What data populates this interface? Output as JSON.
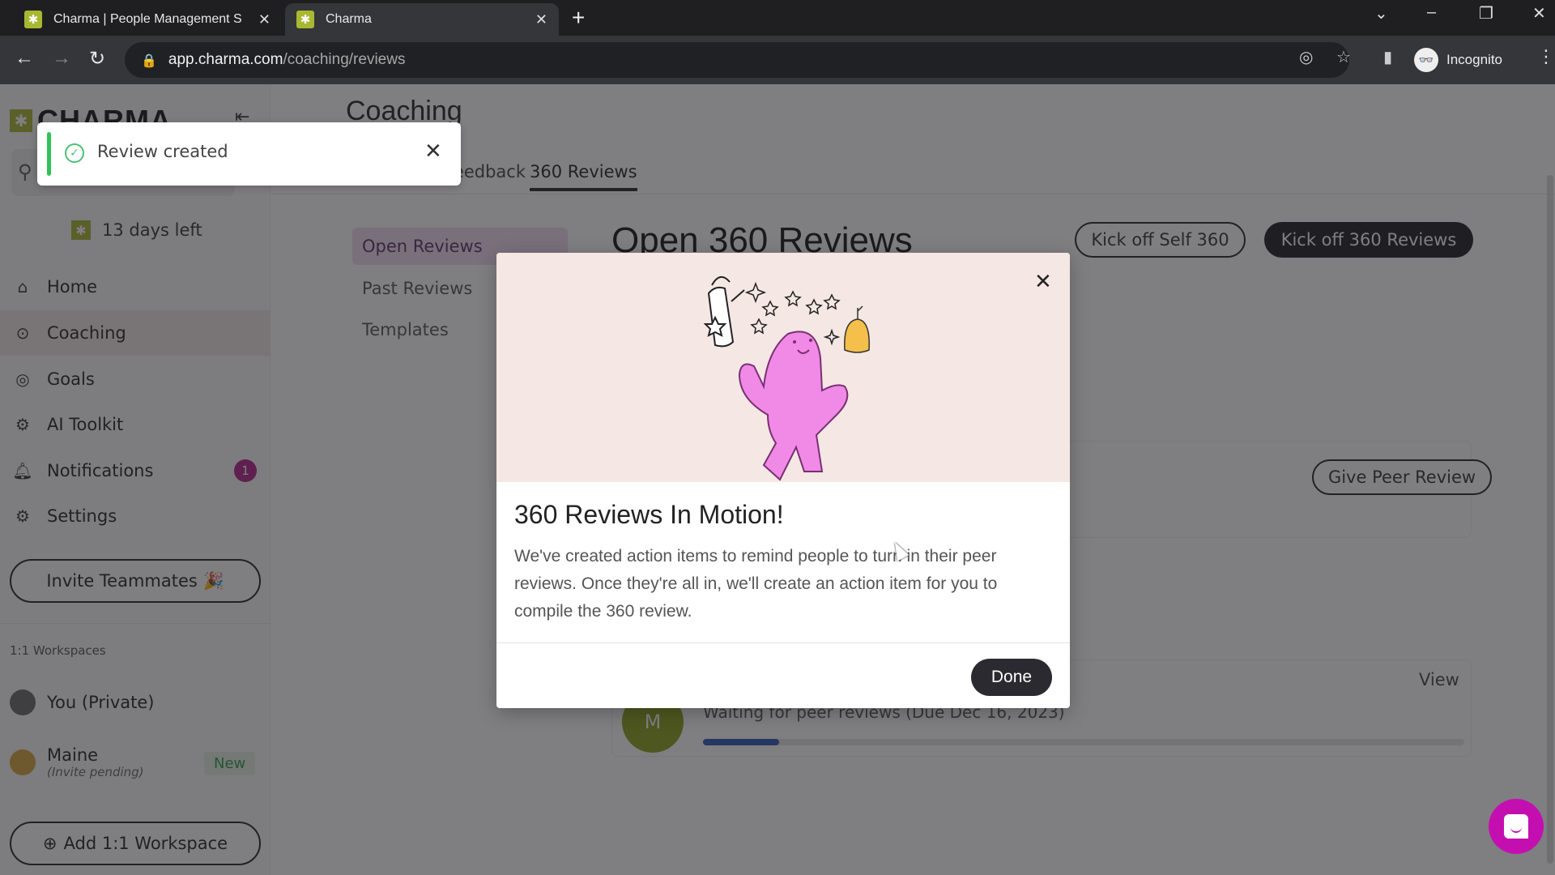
{
  "browser": {
    "tabs": [
      {
        "title": "Charma | People Management S",
        "active": false
      },
      {
        "title": "Charma",
        "active": true
      }
    ],
    "new_tab_icon": "plus-icon",
    "url_host": "app.charma.com",
    "url_path": "/coaching/reviews",
    "profile_label": "Incognito"
  },
  "sidebar": {
    "logo_text": "CHARMA",
    "trial_text": "13 days left",
    "nav": [
      {
        "label": "Home",
        "icon": "home-icon",
        "active": false
      },
      {
        "label": "Coaching",
        "icon": "coaching-whistle-icon",
        "active": true
      },
      {
        "label": "Goals",
        "icon": "target-icon",
        "active": false
      },
      {
        "label": "AI Toolkit",
        "icon": "robot-icon",
        "active": false
      },
      {
        "label": "Notifications",
        "icon": "bell-icon",
        "active": false,
        "badge": "1"
      },
      {
        "label": "Settings",
        "icon": "gear-icon",
        "active": false
      }
    ],
    "invite_label": "Invite Teammates 🎉",
    "workspaces_label": "1:1 Workspaces",
    "workspaces": [
      {
        "name": "You (Private)",
        "sub": ""
      },
      {
        "name": "Maine",
        "sub": "(Invite pending)",
        "badge": "New"
      }
    ],
    "add_workspace_label": "Add 1:1 Workspace"
  },
  "main": {
    "page_title": "Coaching",
    "tabs": [
      {
        "label": "Feedback",
        "visible_fragment": "lback",
        "active": false
      },
      {
        "label": "360 Reviews",
        "active": true
      }
    ],
    "subnav": [
      {
        "label": "Open Reviews",
        "active": true
      },
      {
        "label": "Past Reviews",
        "active": false
      },
      {
        "label": "Templates",
        "active": false
      }
    ],
    "section_title": "Open 360 Reviews",
    "kickoff_self_label": "Kick off Self 360",
    "kickoff_label": "Kick off 360 Reviews",
    "peer_review_label": "Give Peer Review",
    "review_item": {
      "avatar_initial": "M",
      "status": "Waiting for peer reviews (Due Dec 16, 2023)",
      "view_label": "View",
      "progress_percent": 10
    }
  },
  "toast": {
    "message": "Review created",
    "accent": "#31c15a"
  },
  "modal": {
    "title": "360 Reviews In Motion!",
    "body": "We've created action items to remind people to turn in their peer reviews. Once they're all in, we'll create an action item for you to compile the 360 review.",
    "done_label": "Done"
  },
  "colors": {
    "brand": "#a8b830",
    "badge": "#b3218e",
    "progress": "#2b56b5",
    "chat_fab": "#c40fb0"
  }
}
